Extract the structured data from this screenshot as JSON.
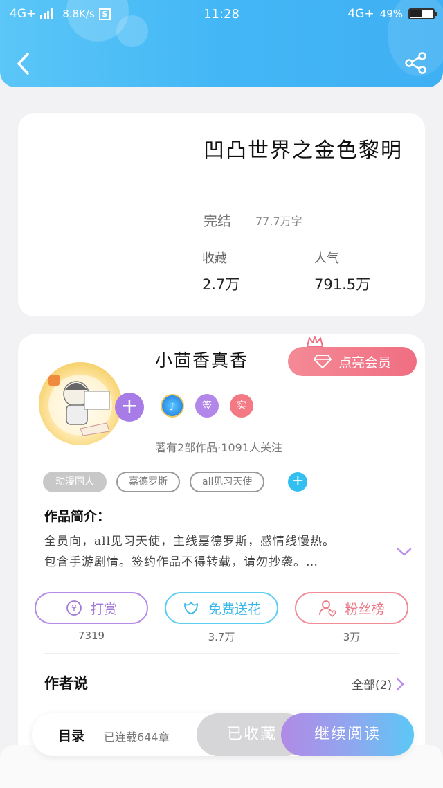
{
  "status_bar": {
    "network_left": "4G+",
    "speed": "8.8K/s",
    "s_icon": "S",
    "time": "11:28",
    "network_right": "4G+",
    "battery": "49%",
    "battery_level": 0.49
  },
  "book": {
    "title": "凹凸世界之金色黎明",
    "status": "完结",
    "word_count": "77.7万字",
    "favorites_label": "收藏",
    "favorites_value": "2.7万",
    "popularity_label": "人气",
    "popularity_value": "791.5万"
  },
  "author": {
    "name": "小茴香真香",
    "vip_label": "点亮会员",
    "badge_sign": "签",
    "badge_real": "实",
    "info": "著有2部作品·1091人关注",
    "tags": [
      "动漫同人",
      "嘉德罗斯",
      "all见习天使"
    ]
  },
  "intro": {
    "label": "作品简介：",
    "line1": "全员向，all见习天使，主线嘉德罗斯，感情线慢热。",
    "line2": "包含手游剧情。签约作品不得转载，请勿抄袭。…"
  },
  "actions": {
    "tip_label": "打赏",
    "tip_count": "7319",
    "flower_label": "免费送花",
    "flower_count": "3.7万",
    "fans_label": "粉丝榜",
    "fans_count": "3万"
  },
  "author_says": {
    "title": "作者说",
    "all_label": "全部(2)"
  },
  "bottom": {
    "toc_label": "目录",
    "updated": "已连载644章",
    "collected_label": "已收藏",
    "continue_label": "继续阅读"
  },
  "colors": {
    "header": "#43b7f6",
    "vip": "#f07484",
    "tip": "#b68be6",
    "flower": "#5ccdf2",
    "fans": "#f08c95"
  }
}
